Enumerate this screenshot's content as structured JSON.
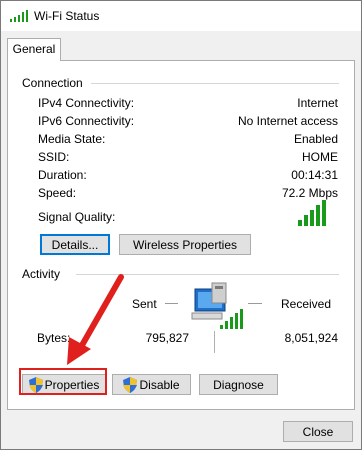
{
  "window": {
    "title": "Wi-Fi Status"
  },
  "tabs": [
    {
      "label": "General"
    }
  ],
  "connection": {
    "heading": "Connection",
    "rows": [
      {
        "label": "IPv4 Connectivity:",
        "value": "Internet"
      },
      {
        "label": "IPv6 Connectivity:",
        "value": "No Internet access"
      },
      {
        "label": "Media State:",
        "value": "Enabled"
      },
      {
        "label": "SSID:",
        "value": "HOME"
      },
      {
        "label": "Duration:",
        "value": "00:14:31"
      },
      {
        "label": "Speed:",
        "value": "72.2 Mbps"
      }
    ],
    "signal_label": "Signal Quality:",
    "signal_bars": 5,
    "details_button": "Details...",
    "wireless_button": "Wireless Properties"
  },
  "activity": {
    "heading": "Activity",
    "sent_label": "Sent",
    "received_label": "Received",
    "bytes_label": "Bytes:",
    "bytes_sent": "795,827",
    "bytes_received": "8,051,924"
  },
  "actions": {
    "properties": "Properties",
    "disable": "Disable",
    "diagnose": "Diagnose"
  },
  "footer": {
    "close": "Close"
  },
  "colors": {
    "signal": "#1a9a1a",
    "accent": "#0078d7",
    "annotation": "#e0201c"
  }
}
